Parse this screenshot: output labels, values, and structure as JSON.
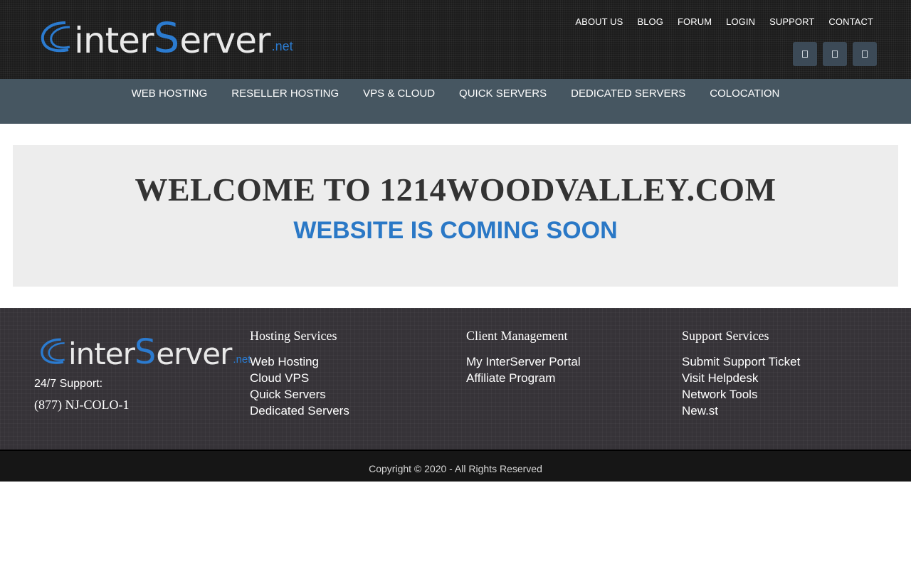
{
  "header": {
    "logo": {
      "text_inter": "inter",
      "text_s": "S",
      "text_erver": "erver",
      "text_net": ".net"
    },
    "top_nav": [
      "ABOUT US",
      "BLOG",
      "FORUM",
      "LOGIN",
      "SUPPORT",
      "CONTACT"
    ],
    "social_icons": [
      "social-icon-1",
      "social-icon-2",
      "social-icon-3"
    ]
  },
  "main_nav": [
    "WEB HOSTING",
    "RESELLER HOSTING",
    "VPS & CLOUD",
    "QUICK SERVERS",
    "DEDICATED SERVERS",
    "COLOCATION"
  ],
  "hero": {
    "title": "WELCOME TO 1214WOODVALLEY.COM",
    "subtitle": "WEBSITE IS COMING SOON"
  },
  "footer": {
    "support_label": "24/7 Support:",
    "support_phone": "(877) NJ-COLO-1",
    "columns": [
      {
        "title": "Hosting Services",
        "links": [
          "Web Hosting",
          "Cloud VPS",
          "Quick Servers",
          "Dedicated Servers"
        ]
      },
      {
        "title": "Client Management",
        "links": [
          "My InterServer Portal",
          "Affiliate Program"
        ]
      },
      {
        "title": "Support Services",
        "links": [
          "Submit Support Ticket",
          "Visit Helpdesk",
          "Network Tools",
          "New.st"
        ]
      }
    ],
    "copyright": "Copyright © 2020 - All Rights Reserved"
  },
  "colors": {
    "accent_blue": "#2a78c6",
    "nav_bar": "#465661",
    "header_bg": "#1c1c1c",
    "footer_bg": "#363338"
  }
}
